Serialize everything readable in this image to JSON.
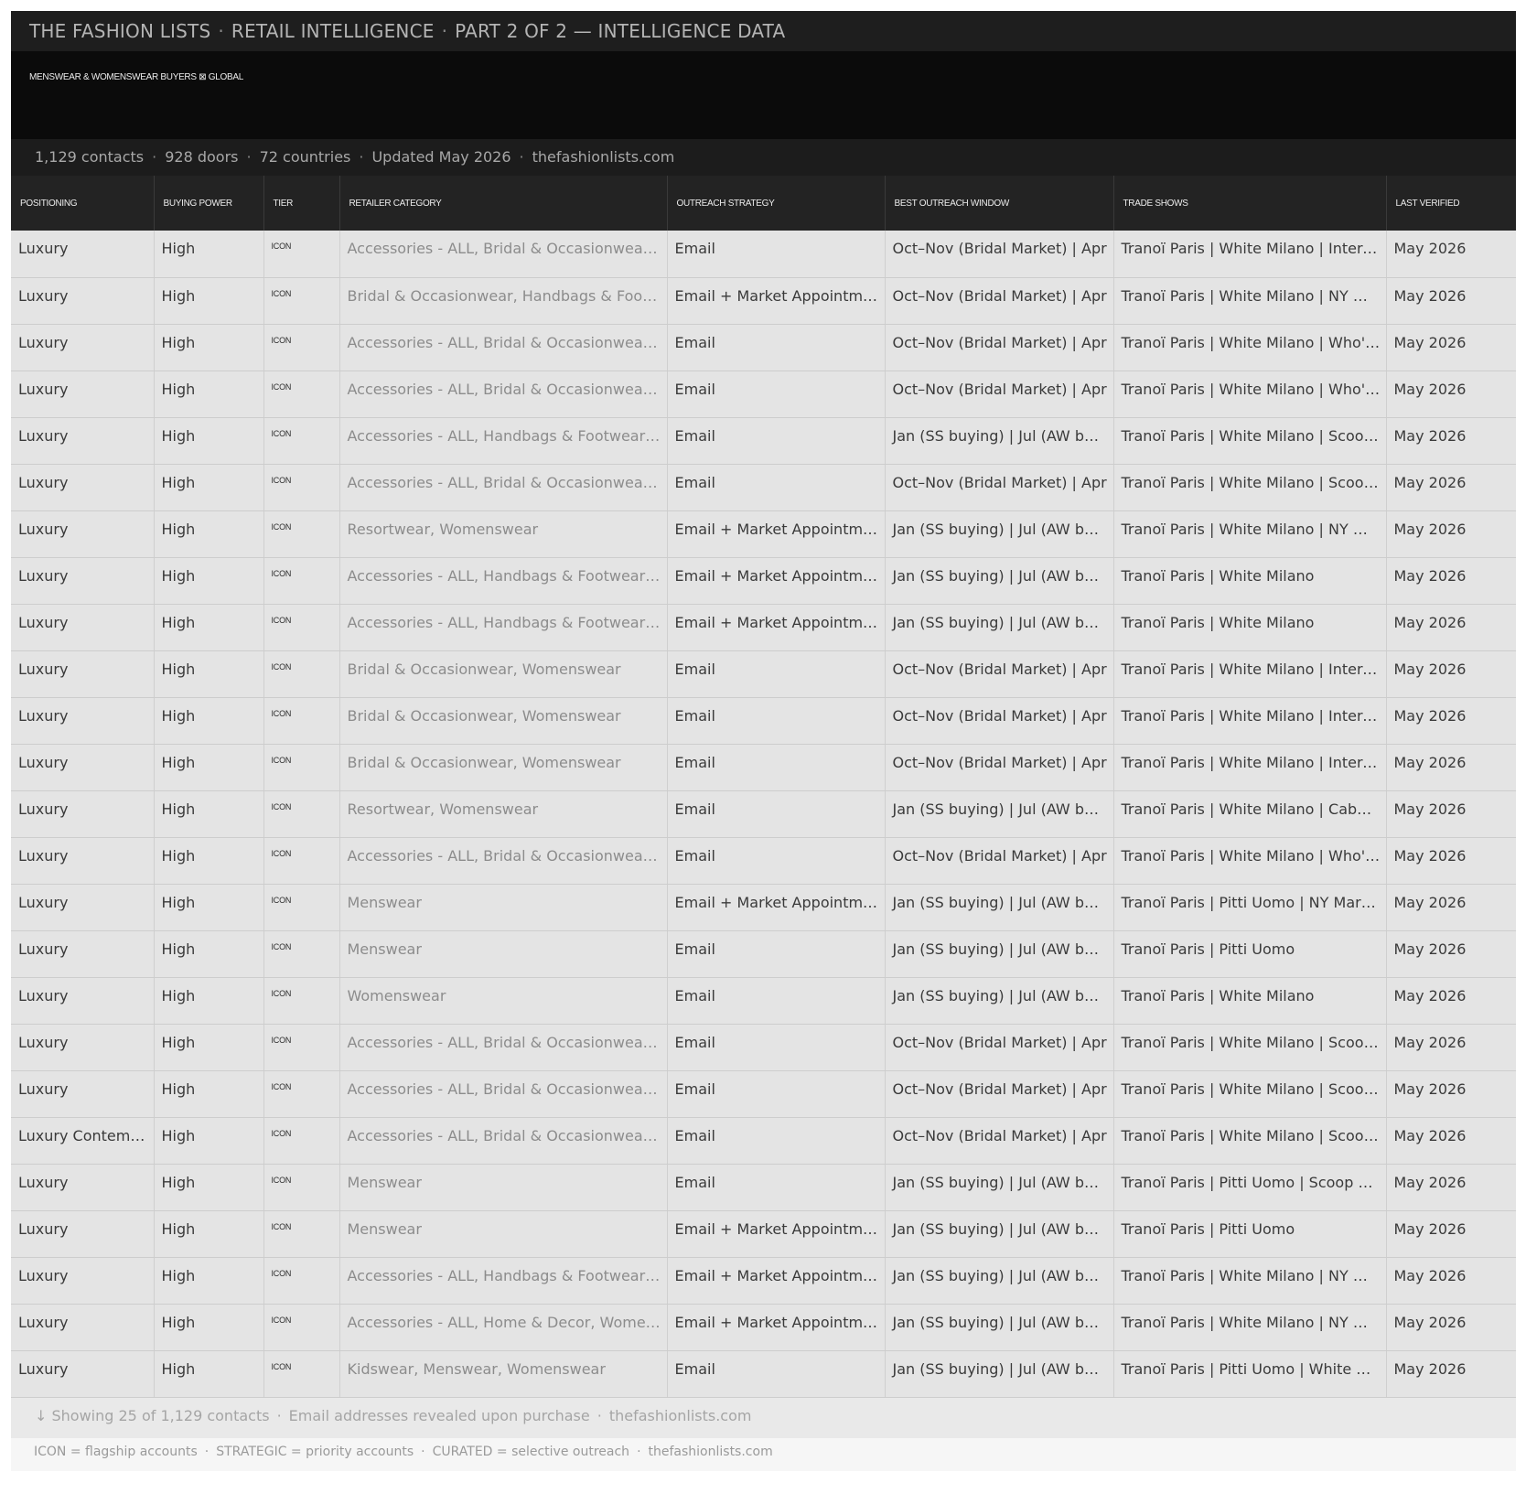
{
  "header": {
    "brand": "THE FASHION LISTS",
    "section": "RETAIL INTELLIGENCE",
    "part": "PART 2 OF 2 — INTELLIGENCE DATA",
    "separator": "·"
  },
  "hero": {
    "subtitle": "MENSWEAR & WOMENSWEAR BUYERS ⊠ GLOBAL"
  },
  "stats": {
    "contacts": "1,129 contacts",
    "doors": "928 doors",
    "countries": "72 countries",
    "updated": "Updated May 2026",
    "site": "thefashionlists.com"
  },
  "table": {
    "columns": [
      "POSITIONING",
      "BUYING POWER",
      "TIER",
      "RETAILER CATEGORY",
      "OUTREACH STRATEGY",
      "BEST OUTREACH WINDOW",
      "TRADE SHOWS",
      "LAST VERIFIED"
    ],
    "rows": [
      [
        "Luxury",
        "High",
        "ICON",
        "Accessories - ALL, Bridal & Occasionwear, Handbags & Footwear",
        "Email",
        "Oct–Nov (Bridal Market) | Apr",
        "Tranoï Paris | White Milano | International",
        "May 2026"
      ],
      [
        "Luxury",
        "High",
        "ICON",
        "Bridal & Occasionwear, Handbags & Footwear",
        "Email + Market Appointment",
        "Oct–Nov (Bridal Market) | Apr",
        "Tranoï Paris | White Milano | NY Market",
        "May 2026"
      ],
      [
        "Luxury",
        "High",
        "ICON",
        "Accessories - ALL, Bridal & Occasionwear, Womenswear",
        "Email",
        "Oct–Nov (Bridal Market) | Apr",
        "Tranoï Paris | White Milano | Who's Next",
        "May 2026"
      ],
      [
        "Luxury",
        "High",
        "ICON",
        "Accessories - ALL, Bridal & Occasionwear, Womenswear",
        "Email",
        "Oct–Nov (Bridal Market) | Apr",
        "Tranoï Paris | White Milano | Who's Next",
        "May 2026"
      ],
      [
        "Luxury",
        "High",
        "ICON",
        "Accessories - ALL, Handbags & Footwear, Womenswear",
        "Email",
        "Jan (SS buying) | Jul (AW buying)",
        "Tranoï Paris | White Milano | Scoop London",
        "May 2026"
      ],
      [
        "Luxury",
        "High",
        "ICON",
        "Accessories - ALL, Bridal & Occasionwear, Womenswear",
        "Email",
        "Oct–Nov (Bridal Market) | Apr",
        "Tranoï Paris | White Milano | Scoop London",
        "May 2026"
      ],
      [
        "Luxury",
        "High",
        "ICON",
        "Resortwear, Womenswear",
        "Email + Market Appointment",
        "Jan (SS buying) | Jul (AW buying)",
        "Tranoï Paris | White Milano | NY Market",
        "May 2026"
      ],
      [
        "Luxury",
        "High",
        "ICON",
        "Accessories - ALL, Handbags & Footwear, Womenswear",
        "Email + Market Appointment",
        "Jan (SS buying) | Jul (AW buying)",
        "Tranoï Paris | White Milano",
        "May 2026"
      ],
      [
        "Luxury",
        "High",
        "ICON",
        "Accessories - ALL, Handbags & Footwear, Womenswear",
        "Email + Market Appointment",
        "Jan (SS buying) | Jul (AW buying)",
        "Tranoï Paris | White Milano",
        "May 2026"
      ],
      [
        "Luxury",
        "High",
        "ICON",
        "Bridal & Occasionwear, Womenswear",
        "Email",
        "Oct–Nov (Bridal Market) | Apr",
        "Tranoï Paris | White Milano | International",
        "May 2026"
      ],
      [
        "Luxury",
        "High",
        "ICON",
        "Bridal & Occasionwear, Womenswear",
        "Email",
        "Oct–Nov (Bridal Market) | Apr",
        "Tranoï Paris | White Milano | International",
        "May 2026"
      ],
      [
        "Luxury",
        "High",
        "ICON",
        "Bridal & Occasionwear, Womenswear",
        "Email",
        "Oct–Nov (Bridal Market) | Apr",
        "Tranoï Paris | White Milano | International",
        "May 2026"
      ],
      [
        "Luxury",
        "High",
        "ICON",
        "Resortwear, Womenswear",
        "Email",
        "Jan (SS buying) | Jul (AW buying)",
        "Tranoï Paris | White Milano | Cabana",
        "May 2026"
      ],
      [
        "Luxury",
        "High",
        "ICON",
        "Accessories - ALL, Bridal & Occasionwear, Womenswear",
        "Email",
        "Oct–Nov (Bridal Market) | Apr",
        "Tranoï Paris | White Milano | Who's Next",
        "May 2026"
      ],
      [
        "Luxury",
        "High",
        "ICON",
        "Menswear",
        "Email + Market Appointment",
        "Jan (SS buying) | Jul (AW buying)",
        "Tranoï Paris | Pitti Uomo | NY Market",
        "May 2026"
      ],
      [
        "Luxury",
        "High",
        "ICON",
        "Menswear",
        "Email",
        "Jan (SS buying) | Jul (AW buying)",
        "Tranoï Paris | Pitti Uomo",
        "May 2026"
      ],
      [
        "Luxury",
        "High",
        "ICON",
        "Womenswear",
        "Email",
        "Jan (SS buying) | Jul (AW buying)",
        "Tranoï Paris | White Milano",
        "May 2026"
      ],
      [
        "Luxury",
        "High",
        "ICON",
        "Accessories - ALL, Bridal & Occasionwear, Womenswear",
        "Email",
        "Oct–Nov (Bridal Market) | Apr",
        "Tranoï Paris | White Milano | Scoop London",
        "May 2026"
      ],
      [
        "Luxury",
        "High",
        "ICON",
        "Accessories - ALL, Bridal & Occasionwear, Womenswear",
        "Email",
        "Oct–Nov (Bridal Market) | Apr",
        "Tranoï Paris | White Milano | Scoop London",
        "May 2026"
      ],
      [
        "Luxury Contemporary",
        "High",
        "ICON",
        "Accessories - ALL, Bridal & Occasionwear, Womenswear",
        "Email",
        "Oct–Nov (Bridal Market) | Apr",
        "Tranoï Paris | White Milano | Scoop London",
        "May 2026"
      ],
      [
        "Luxury",
        "High",
        "ICON",
        "Menswear",
        "Email",
        "Jan (SS buying) | Jul (AW buying)",
        "Tranoï Paris | Pitti Uomo | Scoop London",
        "May 2026"
      ],
      [
        "Luxury",
        "High",
        "ICON",
        "Menswear",
        "Email + Market Appointment",
        "Jan (SS buying) | Jul (AW buying)",
        "Tranoï Paris | Pitti Uomo",
        "May 2026"
      ],
      [
        "Luxury",
        "High",
        "ICON",
        "Accessories - ALL, Handbags & Footwear, Womenswear",
        "Email + Market Appointment",
        "Jan (SS buying) | Jul (AW buying)",
        "Tranoï Paris | White Milano | NY Market",
        "May 2026"
      ],
      [
        "Luxury",
        "High",
        "ICON",
        "Accessories - ALL, Home & Decor, Womenswear",
        "Email + Market Appointment",
        "Jan (SS buying) | Jul (AW buying)",
        "Tranoï Paris | White Milano | NY Market",
        "May 2026"
      ],
      [
        "Luxury",
        "High",
        "ICON",
        "Kidswear, Menswear, Womenswear",
        "Email",
        "Jan (SS buying) | Jul (AW buying)",
        "Tranoï Paris | Pitti Uomo | White Milano",
        "May 2026"
      ]
    ]
  },
  "footer": {
    "arrow": "↓",
    "showing": "Showing 25 of 1,129 contacts",
    "note": "Email addresses revealed upon purchase",
    "site": "thefashionlists.com",
    "legend_icon": "ICON = flagship accounts",
    "legend_strategic": "STRATEGIC = priority accounts",
    "legend_curated": "CURATED = selective outreach",
    "legend_site": "thefashionlists.com"
  },
  "colors": {
    "header_bg": "#1e1e1e",
    "hero_bg": "#0b0b0b",
    "row_bg": "#e4e4e4",
    "muted_text": "#8c8c8c"
  }
}
